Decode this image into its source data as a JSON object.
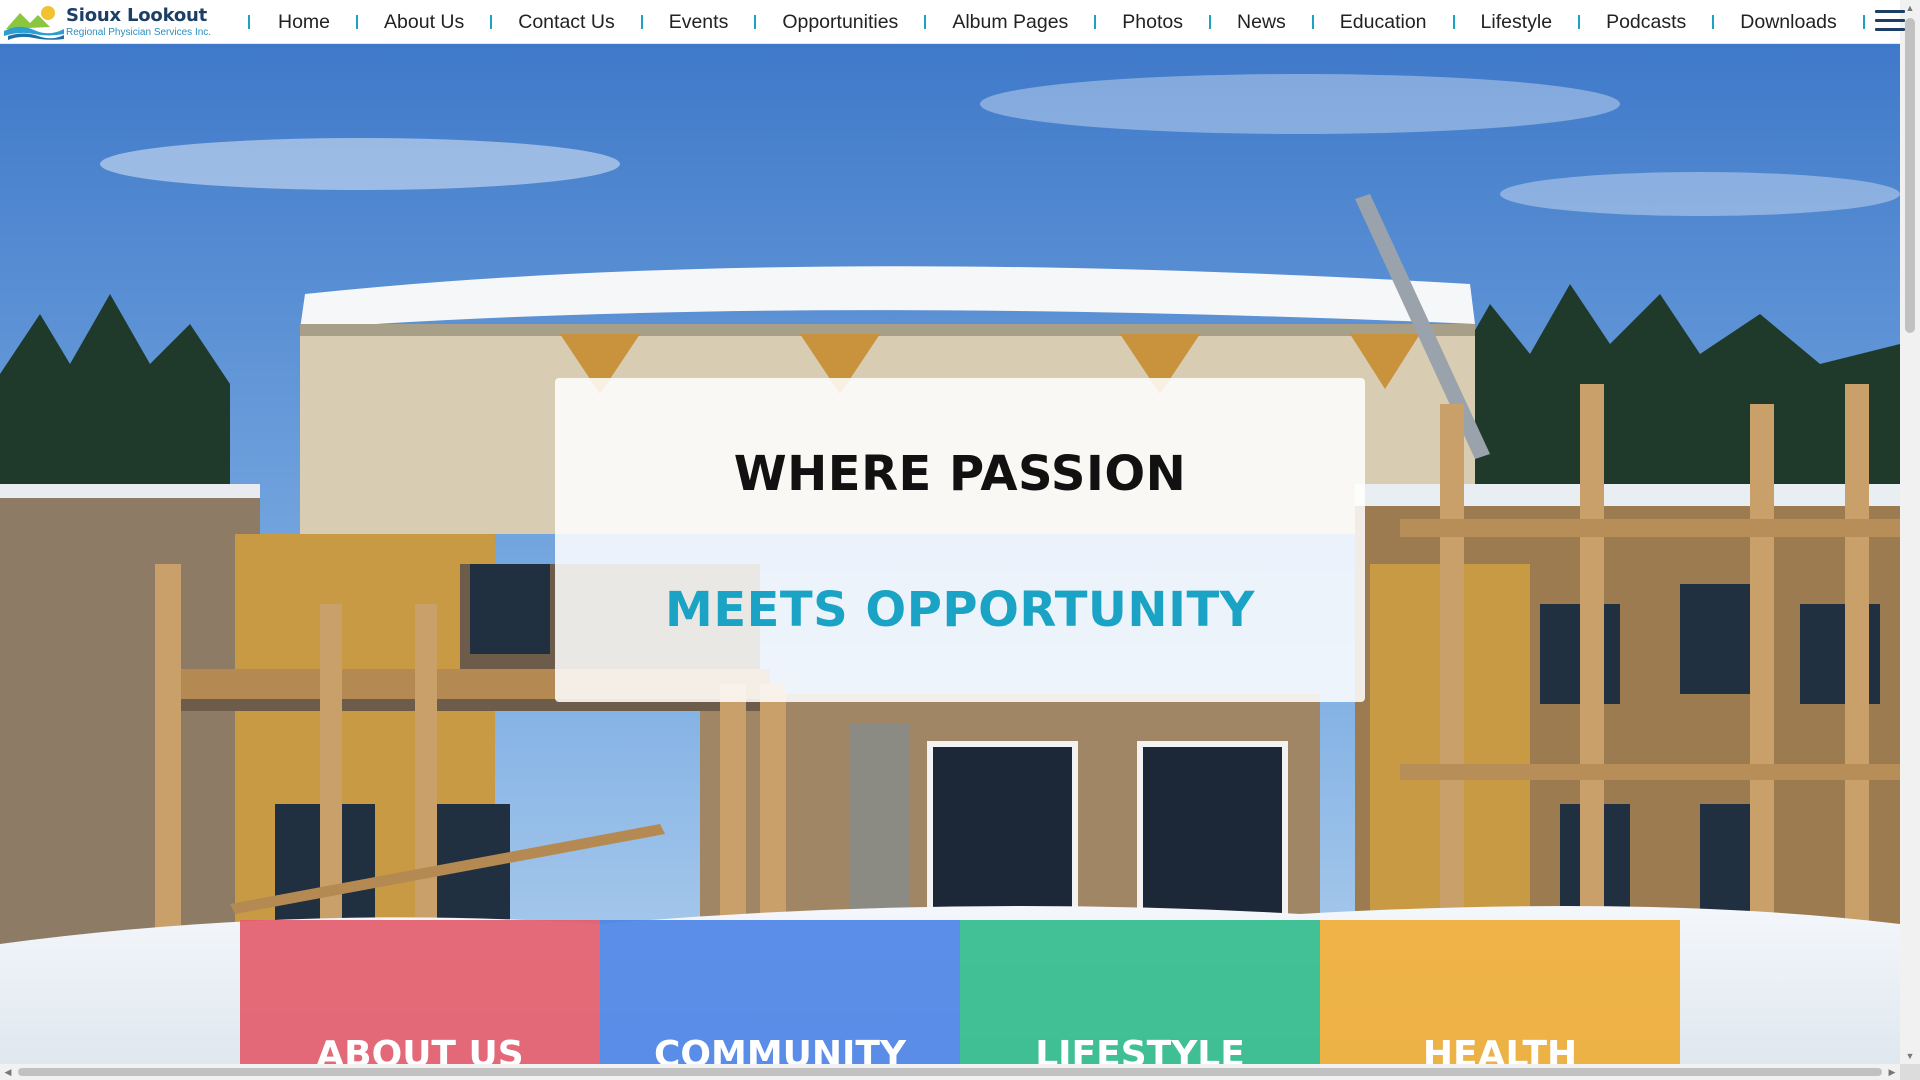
{
  "brand": {
    "title": "Sioux Lookout",
    "subtitle": "Regional Physician Services Inc."
  },
  "nav": {
    "items": [
      {
        "label": "Home"
      },
      {
        "label": "About Us"
      },
      {
        "label": "Contact Us"
      },
      {
        "label": "Events"
      },
      {
        "label": "Opportunities"
      },
      {
        "label": "Album Pages"
      },
      {
        "label": "Photos"
      },
      {
        "label": "News"
      },
      {
        "label": "Education"
      },
      {
        "label": "Lifestyle"
      },
      {
        "label": "Podcasts"
      },
      {
        "label": "Downloads"
      }
    ],
    "menu_icon": "hamburger-menu-icon"
  },
  "hero": {
    "line1": "WHERE PASSION",
    "line2": "MEETS OPPORTUNITY",
    "accent_color": "#1aa3c4"
  },
  "tiles": [
    {
      "label": "ABOUT US",
      "color": "#e35b6a"
    },
    {
      "label": "COMMUNITY",
      "color": "#4a83e6"
    },
    {
      "label": "LIFESTYLE",
      "color": "#2fba8b"
    },
    {
      "label": "HEALTH",
      "color": "#eeac33"
    }
  ]
}
